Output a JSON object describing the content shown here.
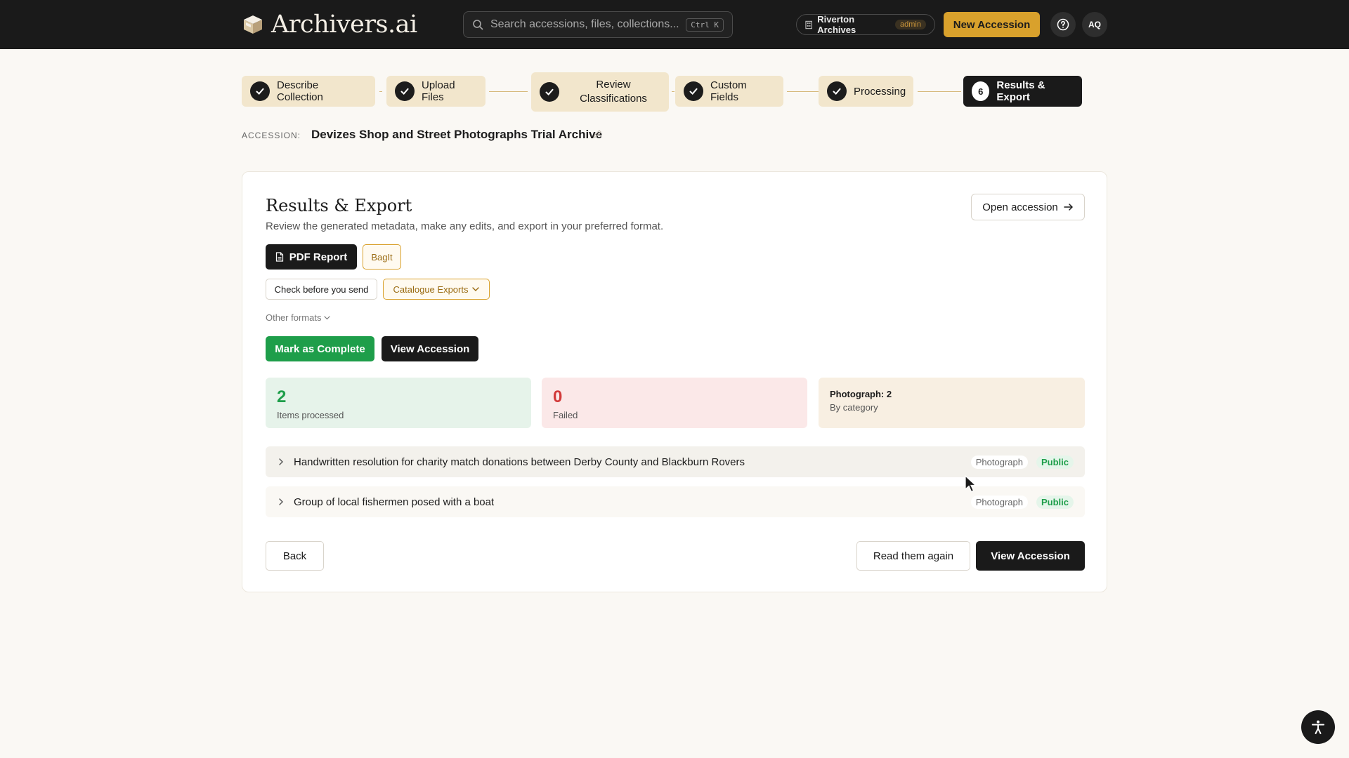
{
  "app": {
    "logo_text": "Archivers.ai",
    "search_placeholder": "Search accessions, files, collections...",
    "search_shortcut": "Ctrl K",
    "org_name": "Riverton Archives",
    "org_role": "admin",
    "new_accession_label": "New Accession",
    "avatar_initials": "AQ"
  },
  "steps": [
    {
      "label": "Describe Collection",
      "state": "done"
    },
    {
      "label": "Upload Files",
      "state": "done"
    },
    {
      "label_line1": "Review",
      "label_line2": "Classifications",
      "state": "done"
    },
    {
      "label": "Custom Fields",
      "state": "done"
    },
    {
      "label": "Processing",
      "state": "done"
    },
    {
      "number": "6",
      "label": "Results & Export",
      "state": "active"
    }
  ],
  "accession": {
    "label": "ACCESSION:",
    "title": "Devizes Shop and Street Photographs Trial Archive"
  },
  "results": {
    "title": "Results & Export",
    "subtitle": "Review the generated metadata, make any edits, and export in your preferred format.",
    "open_accession_label": "Open accession",
    "pdf_report_label": "PDF Report",
    "bagit_label": "BagIt",
    "check_label": "Check before you send",
    "catalogue_exports_label": "Catalogue Exports",
    "other_formats_label": "Other formats",
    "mark_complete_label": "Mark as Complete",
    "view_accession_label": "View Accession"
  },
  "stats": {
    "processed_value": "2",
    "processed_label": "Items processed",
    "failed_value": "0",
    "failed_label": "Failed",
    "category_value": "Photograph: 2",
    "category_label": "By category"
  },
  "items": [
    {
      "title": "Handwritten resolution for charity match donations between Derby County and Blackburn Rovers",
      "category": "Photograph",
      "access": "Public"
    },
    {
      "title": "Group of local fishermen posed with a boat",
      "category": "Photograph",
      "access": "Public"
    }
  ],
  "footer": {
    "back_label": "Back",
    "read_again_label": "Read them again",
    "view_accession_label": "View Accession"
  },
  "colors": {
    "topbar": "#1a1a1a",
    "accent_gold": "#d9a12c",
    "step_done_bg": "#f2e6cc",
    "success_green": "#1e9e4a",
    "failed_red": "#d23a3a"
  },
  "icons": [
    "logo-box-icon",
    "search-icon",
    "building-icon",
    "help-icon",
    "check-icon",
    "pencil-icon",
    "arrow-right-icon",
    "document-icon",
    "chevron-down-icon",
    "chevron-right-icon",
    "accessibility-icon",
    "mouse-cursor-icon"
  ]
}
